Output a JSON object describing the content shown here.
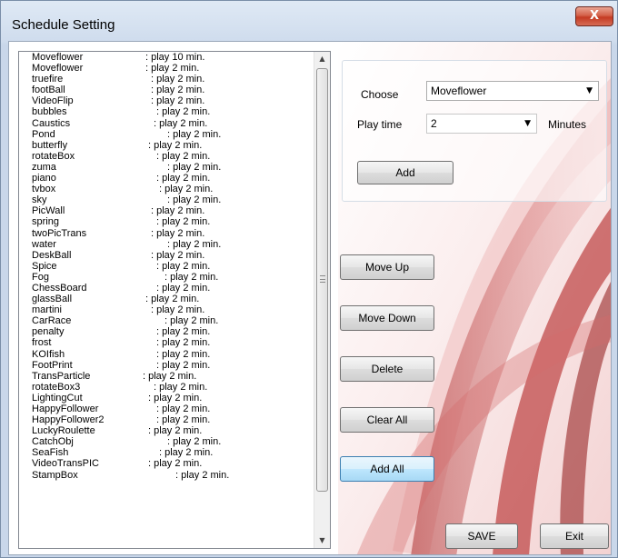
{
  "window": {
    "title": "Schedule Setting",
    "close_label": "X"
  },
  "schedule": [
    {
      "name": "Moveflower",
      "duration": ": play 10 min."
    },
    {
      "name": "Moveflower",
      "duration": ": play 2 min."
    },
    {
      "name": "truefire",
      "duration": ": play 2 min."
    },
    {
      "name": "footBall",
      "duration": ": play 2 min."
    },
    {
      "name": "VideoFlip",
      "duration": ": play 2 min."
    },
    {
      "name": "bubbles",
      "duration": ": play 2 min."
    },
    {
      "name": "Caustics",
      "duration": ": play 2 min."
    },
    {
      "name": "Pond",
      "duration": ": play 2 min."
    },
    {
      "name": "butterfly",
      "duration": ": play 2 min."
    },
    {
      "name": "rotateBox",
      "duration": ": play 2 min."
    },
    {
      "name": "zuma",
      "duration": ": play 2 min."
    },
    {
      "name": "piano",
      "duration": ": play 2 min."
    },
    {
      "name": "tvbox",
      "duration": ": play 2 min."
    },
    {
      "name": "sky",
      "duration": ": play 2 min."
    },
    {
      "name": "PicWall",
      "duration": ": play 2 min."
    },
    {
      "name": "spring",
      "duration": ": play 2 min."
    },
    {
      "name": "twoPicTrans",
      "duration": ": play 2 min."
    },
    {
      "name": "water",
      "duration": ": play 2 min."
    },
    {
      "name": "DeskBall",
      "duration": ": play 2 min."
    },
    {
      "name": "Spice",
      "duration": ": play 2 min."
    },
    {
      "name": "Fog",
      "duration": ": play 2 min."
    },
    {
      "name": "ChessBoard",
      "duration": ": play 2 min."
    },
    {
      "name": "glassBall",
      "duration": ": play 2 min."
    },
    {
      "name": "martini",
      "duration": ": play 2 min."
    },
    {
      "name": "CarRace",
      "duration": ": play 2 min."
    },
    {
      "name": "penalty",
      "duration": ": play 2 min."
    },
    {
      "name": "frost",
      "duration": ": play 2 min."
    },
    {
      "name": "KOIfish",
      "duration": ": play 2 min."
    },
    {
      "name": "FootPrint",
      "duration": ": play 2 min."
    },
    {
      "name": "TransParticle",
      "duration": ": play 2 min."
    },
    {
      "name": "rotateBox3",
      "duration": ": play 2 min."
    },
    {
      "name": "LightingCut",
      "duration": ": play 2 min."
    },
    {
      "name": "HappyFollower",
      "duration": ": play 2 min."
    },
    {
      "name": "HappyFollower2",
      "duration": ": play 2 min."
    },
    {
      "name": "LuckyRoulette",
      "duration": ": play 2 min."
    },
    {
      "name": "CatchObj",
      "duration": ": play 2 min."
    },
    {
      "name": "SeaFish",
      "duration": ": play 2 min."
    },
    {
      "name": "VideoTransPIC",
      "duration": ": play 2 min."
    },
    {
      "name": "StampBox",
      "duration": ": play 2 min."
    }
  ],
  "chooser": {
    "choose_label": "Choose",
    "choose_value": "Moveflower",
    "playtime_label": "Play time",
    "playtime_value": "2",
    "minutes_label": "Minutes",
    "add_label": "Add"
  },
  "actions": {
    "move_up": "Move Up",
    "move_down": "Move Down",
    "delete": "Delete",
    "clear_all": "Clear All",
    "add_all": "Add All"
  },
  "footer": {
    "save": "SAVE",
    "exit": "Exit"
  },
  "colors": {
    "accent_red": "#c0392b",
    "close_red": "#c43a22",
    "focus_blue": "#3c7fb1"
  }
}
